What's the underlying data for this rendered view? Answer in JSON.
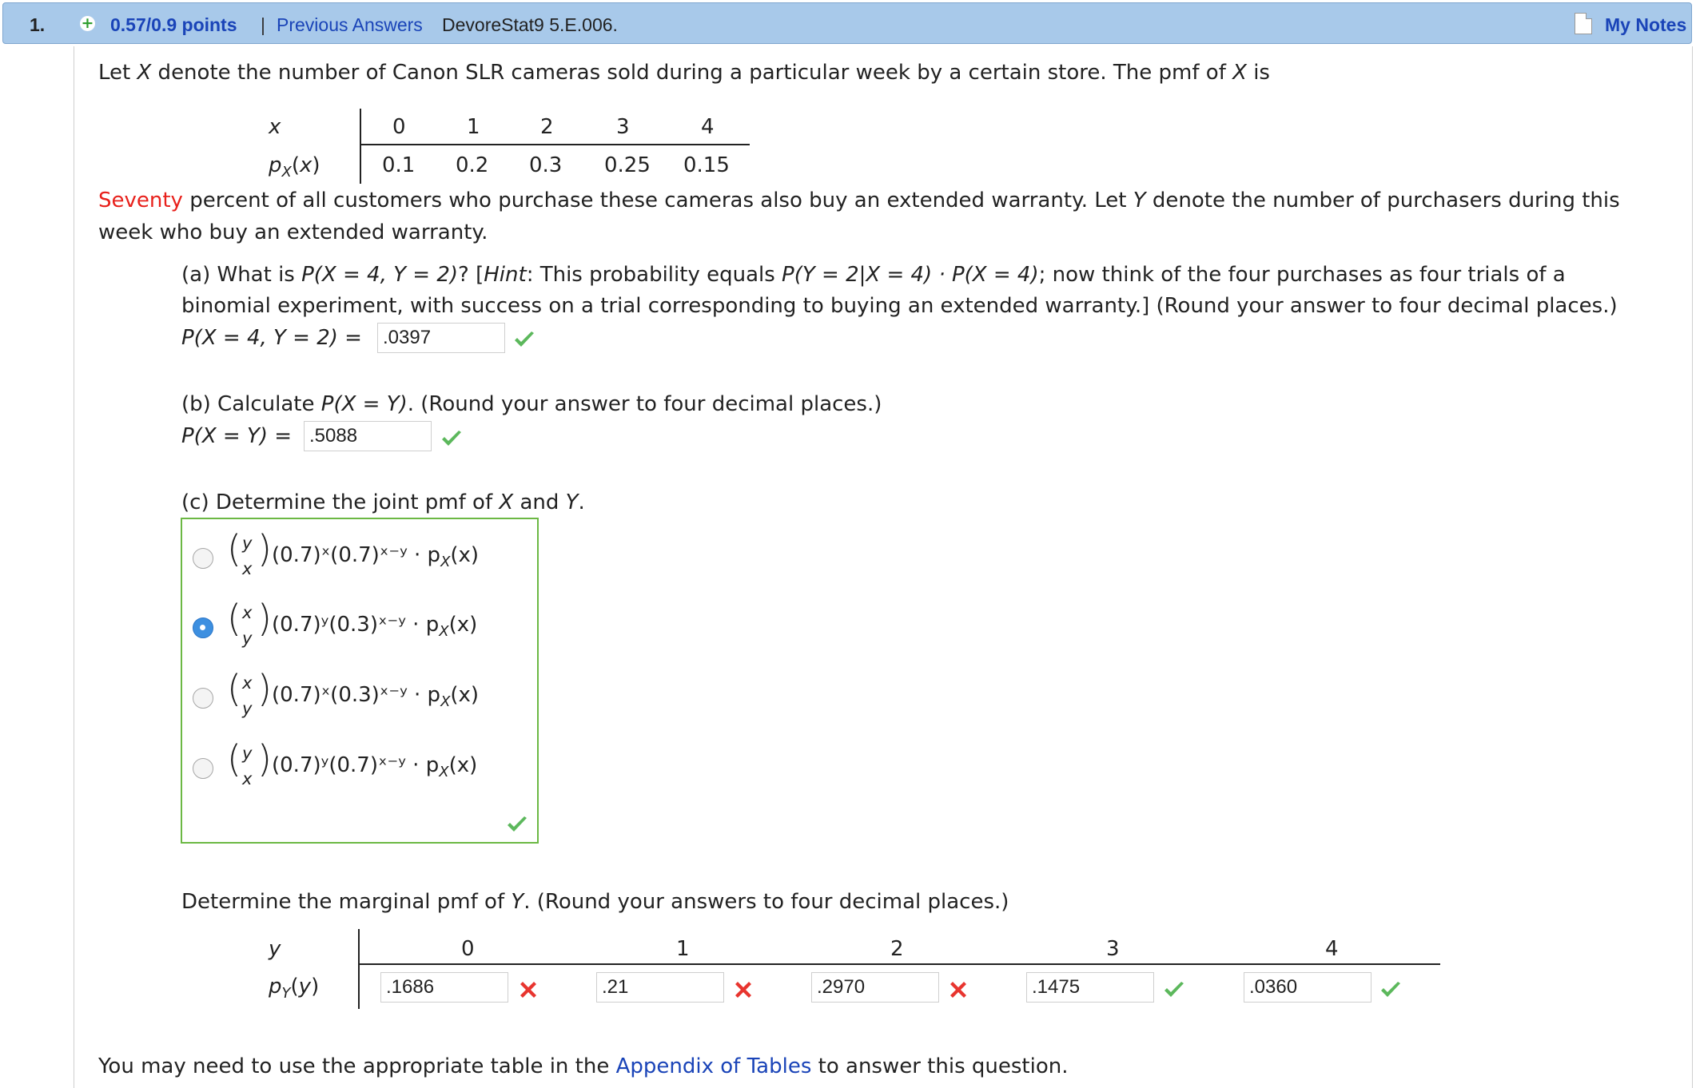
{
  "header": {
    "question_number": "1.",
    "points": "0.57/0.9 points",
    "separator": "|",
    "previous_answers": "Previous Answers",
    "source": "DevoreStat9 5.E.006.",
    "my_notes": "My Notes"
  },
  "intro": {
    "text_1": "Let ",
    "var_x": "X",
    "text_2": " denote the number of Canon SLR cameras sold during a particular week by a certain store. The pmf of ",
    "var_x2": "X",
    "text_3": " is"
  },
  "pmf_x": {
    "row_label_x": "x",
    "row_label_p": "p",
    "row_label_p_sub": "X",
    "row_label_p_arg": "(x)",
    "x_values": [
      "0",
      "1",
      "2",
      "3",
      "4"
    ],
    "p_values": [
      "0.1",
      "0.2",
      "0.3",
      "0.25",
      "0.15"
    ]
  },
  "warranty": {
    "seventy": "Seventy",
    "text_1": " percent of all customers who purchase these cameras also buy an extended warranty. Let ",
    "var_y": "Y",
    "text_2": " denote the number of purchasers during this",
    "line_2": "week who buy an extended warranty."
  },
  "part_a": {
    "line1_a": "(a) What is ",
    "line1_expr": "P(X = 4, Y = 2)",
    "line1_b": "? [",
    "hint_word": "Hint",
    "line1_c": ": This probability equals  ",
    "line1_expr2": "P(Y = 2|X = 4) · P(X = 4)",
    "line1_d": ";  now think of the four purchases as four trials of a",
    "line2": "binomial experiment, with success on a trial corresponding to buying an extended warranty.] (Round your answer to four decimal places.)",
    "answer_label": "P(X = 4, Y = 2)  =",
    "answer_value": ".0397"
  },
  "part_b": {
    "line1_a": "(b) Calculate ",
    "line1_expr": "P(X = Y)",
    "line1_b": ". (Round your answer to four decimal places.)",
    "answer_label": "P(X = Y)  =",
    "answer_value": ".5088"
  },
  "part_c": {
    "line1_a": "(c) Determine the joint pmf of ",
    "var_x": "X",
    "line1_b": " and ",
    "var_y": "Y",
    "line1_c": ".",
    "choices": [
      {
        "top": "y",
        "bot": "x",
        "expr": "(0.7)ˣ(0.7)ˣ⁻ʸ · p",
        "sub": "X",
        "arg": "(x)"
      },
      {
        "top": "x",
        "bot": "y",
        "expr": "(0.7)ʸ(0.3)ˣ⁻ʸ · p",
        "sub": "X",
        "arg": "(x)"
      },
      {
        "top": "x",
        "bot": "y",
        "expr": "(0.7)ˣ(0.3)ˣ⁻ʸ · p",
        "sub": "X",
        "arg": "(x)"
      },
      {
        "top": "y",
        "bot": "x",
        "expr": "(0.7)ʸ(0.7)ˣ⁻ʸ · p",
        "sub": "X",
        "arg": "(x)"
      }
    ],
    "selected_index": 1
  },
  "marginal": {
    "line_a": "Determine the marginal pmf of ",
    "var_y": "Y",
    "line_b": ". (Round your answers to four decimal places.)",
    "row_label_y": "y",
    "row_label_p": "p",
    "row_label_p_sub": "Y",
    "row_label_p_arg": "(y)",
    "y_values": [
      "0",
      "1",
      "2",
      "3",
      "4"
    ],
    "answers": [
      ".1686",
      ".21",
      ".2970",
      ".1475",
      ".0360"
    ],
    "results": [
      "incorrect",
      "incorrect",
      "incorrect",
      "correct",
      "correct"
    ]
  },
  "footer": {
    "text_1": "You may need to use the appropriate table in the ",
    "link": "Appendix of Tables",
    "text_2": " to answer this question."
  },
  "colors": {
    "header_bg": "#a8c9ea",
    "link_blue": "#1a44b8",
    "red_text": "#e8211c",
    "check_green": "#5cb85c",
    "cross_red": "#e8352f",
    "choice_border": "#6cb844"
  }
}
